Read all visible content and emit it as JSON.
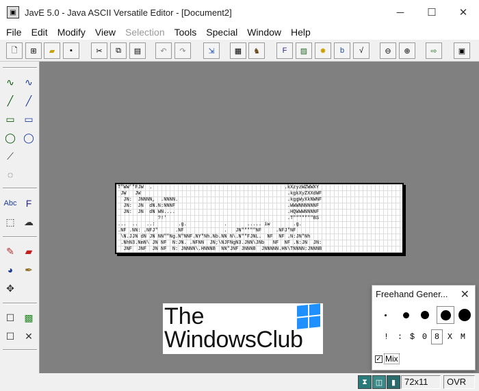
{
  "window": {
    "title": "JavE 5.0 - Java ASCII Versatile Editor - [Document2]",
    "minimize_glyph": "─",
    "maximize_glyph": "☐",
    "close_glyph": "✕"
  },
  "menubar": {
    "items": [
      "File",
      "Edit",
      "Modify",
      "View",
      "Selection",
      "Tools",
      "Special",
      "Window",
      "Help"
    ]
  },
  "document": {
    "ascii_lines": [
      "T\"WW'\"FJW  .                                              .kXzyzWZWWXY",
      " JW   JW                                                   .kgkXyZXXdWF",
      "  JN:  JNNNN,  .NNNN.                                      .kggWyXkNWNF",
      "  JN:  JN  dN.N:NNNF                                       .WWWNNNNNNF",
      "  JN:  JN  dN WN....                                       .HQWWWNNNNF",
      "              ?!'                                          .T\"\"\"\"\"\"\"BS",
      "...  ..   ..:        .g.             .       ..... iw        .g.",
      ".NF .NN: .NFJ\"      .NF              .   JN\"\"\"\"\"NF     .NFJ\"NF",
      " \\N.JJN dN JN NN\"\"Ng.N\"NNF.NY\"Nh.Nb.NN N\\.N\"\"FJNL.  NF  NF .N:JN\"Nh",
      " .NhN3.NmN\\ JN NF  N:JN. .NFNN  JN;\\NJFNgN3.JNN\\JNb   NF  NF .N:JN  JN:",
      "  JNF  JNF  JN NF  N: JNNNN\\.HNNNB  NN\"JNF JNNNB  JNNNNN.HN\\TNNNN:JNNNB"
    ]
  },
  "watermark": {
    "line1": "The",
    "line2": "WindowsClub"
  },
  "freehand_panel": {
    "title": "Freehand Gener...",
    "close_glyph": "✕",
    "chars": [
      "!",
      ":",
      "$",
      "0",
      "8",
      "X",
      "M"
    ],
    "mix_label": "Mix",
    "mix_checked_glyph": "✓"
  },
  "statusbar": {
    "size": "72x11",
    "mode": "OVR"
  },
  "icons": [
    "app-icon",
    "new-doc-icon",
    "new-tree-icon",
    "open-folder-icon",
    "save-disk-icon",
    "cut-icon",
    "copy-icon",
    "paste-icon",
    "undo-icon",
    "redo-icon",
    "resize-icon",
    "film-icon",
    "camel-icon",
    "font-icon",
    "image-convert-icon",
    "settings-gear-icon",
    "text-box-icon",
    "formula-icon",
    "zoom-out-icon",
    "zoom-in-icon",
    "export-icon",
    "app-small-icon",
    "freehand-icon",
    "line-icon",
    "rectangle-icon",
    "ellipse-icon",
    "polyline-icon",
    "circle-icon",
    "text-icon",
    "font-tool-icon",
    "select-rect-icon",
    "lasso-icon",
    "brush-icon",
    "eraser-icon",
    "fill-icon",
    "pen-icon",
    "move-icon",
    "image-icon",
    "axes-icon",
    "hourglass-icon",
    "mouse-icon",
    "cursor-icon"
  ]
}
